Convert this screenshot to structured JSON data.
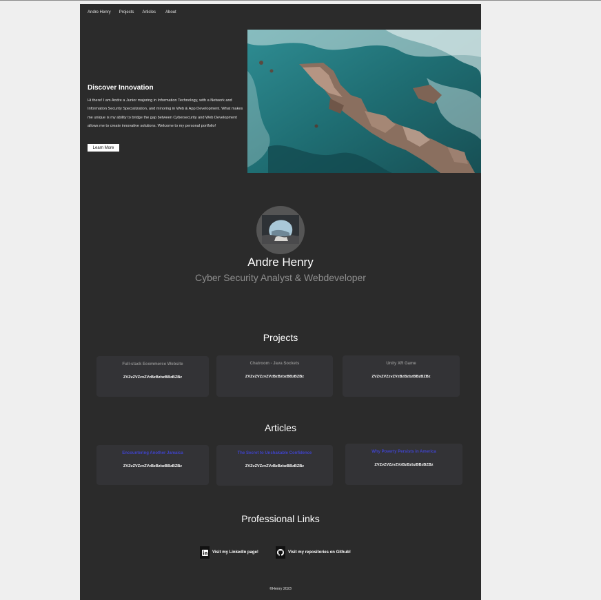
{
  "nav": {
    "brand": "Andre Henry",
    "items": [
      "Projects",
      "Articles",
      "About"
    ]
  },
  "hero": {
    "title": "Discover Innovation",
    "text": "Hi there! I am Andre a Junior majoring in Information Technology, with a Network and Information Security Specialization, and minoring in Web & App Development. What makes me unique is my ability to bridge the gap between Cybersecurity and Web Development allows me to create innovative solutions. Welcome to my personal portfolio!",
    "button": "Learn More"
  },
  "profile": {
    "name": "Andre Henry",
    "role": "Cyber Security Analyst & Webdeveloper"
  },
  "projects": {
    "title": "Projects",
    "cards": [
      {
        "title": "Full-stack Ecommerce Website",
        "desc": "ZVZvZVZzvZVzBzBzbzBBzBZBz"
      },
      {
        "title": "Chatroom - Java Sockets",
        "desc": "ZVZvZVZzvZVzBzBzbzBBzBZBz"
      },
      {
        "title": "Unity XR Game",
        "desc": "ZVZvZVZzvZVzBzBzbzBBzBZBz"
      }
    ]
  },
  "articles": {
    "title": "Articles",
    "cards": [
      {
        "title": "Encountering Another Jamaica",
        "desc": "ZVZvZVZzvZVzBzBzbzBBzBZBz"
      },
      {
        "title": "The Secret to Unshakable Confidence",
        "desc": "ZVZvZVZzvZVzBzBzbzBBzBZBz"
      },
      {
        "title": "Why Poverty Persists in America",
        "desc": "ZVZvZVZzvZVzBzBzbzBBzBZBz"
      }
    ]
  },
  "links": {
    "title": "Professional Links",
    "linkedin": "Visit my LinkedIn page!",
    "github": "Visit my repositories on Github!"
  },
  "footer": "©Henry 2023",
  "colors": {
    "page_bg": "#2b2b2b",
    "card_bg": "#333336",
    "article_title": "#3f43c9"
  }
}
